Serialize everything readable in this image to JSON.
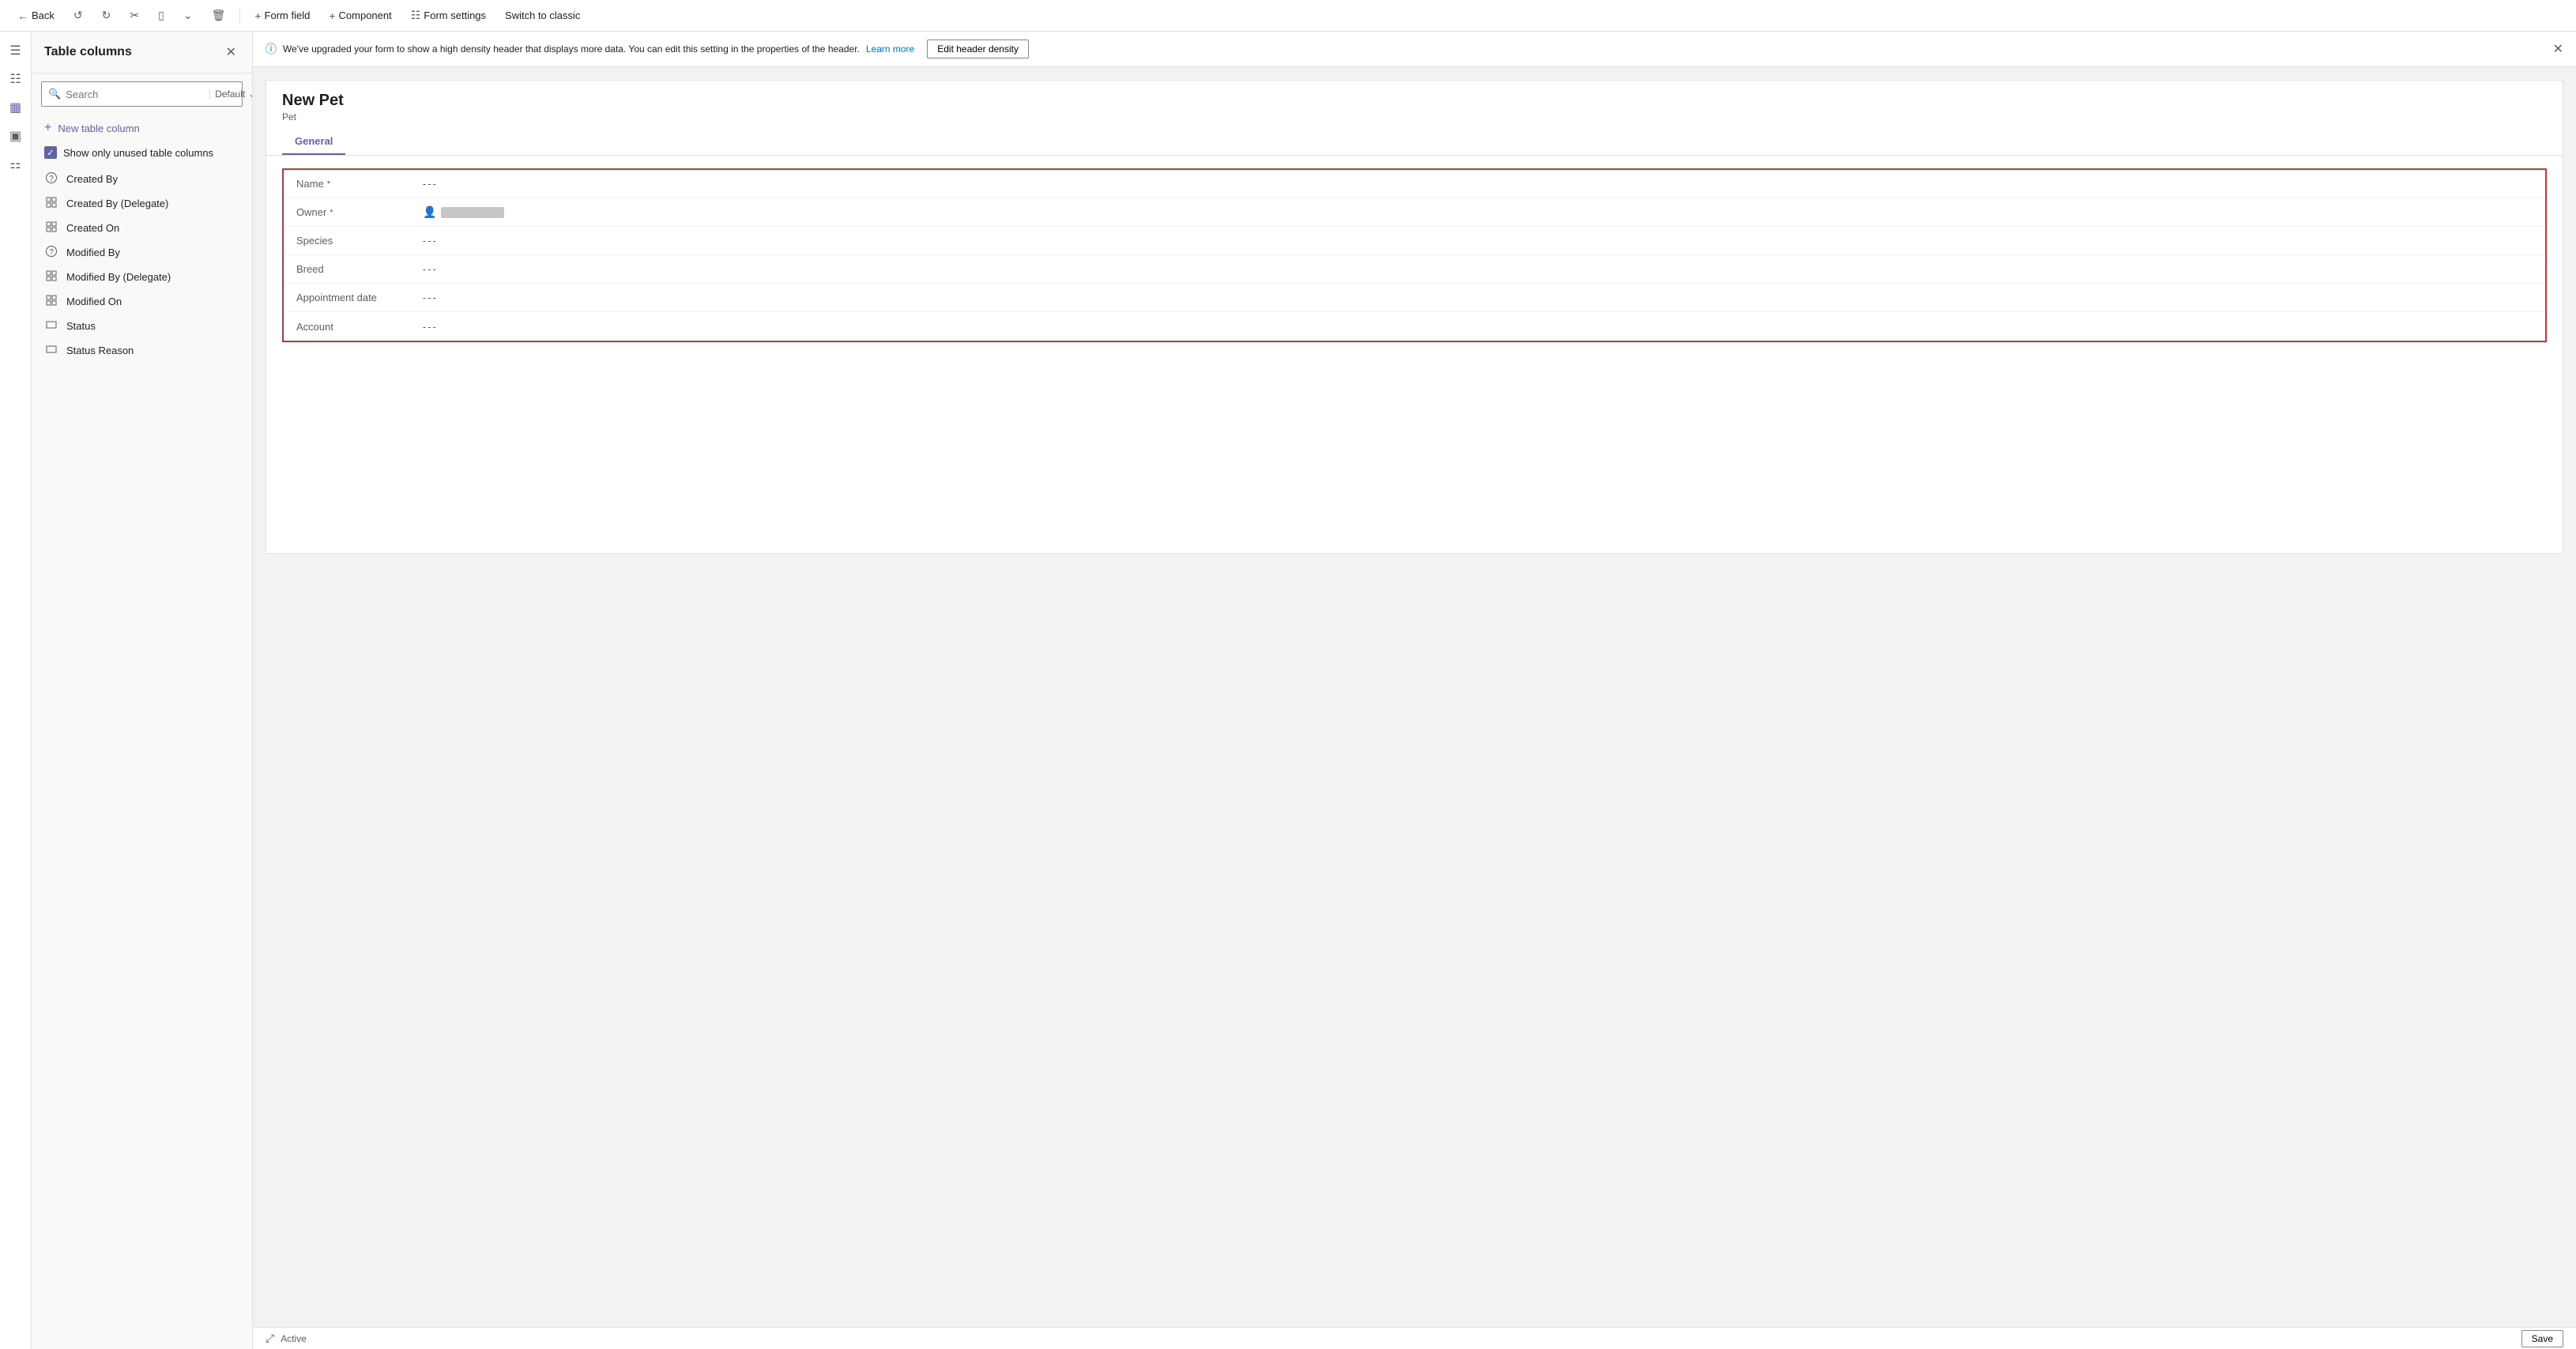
{
  "toolbar": {
    "back_label": "Back",
    "form_field_label": "Form field",
    "component_label": "Component",
    "form_settings_label": "Form settings",
    "switch_classic_label": "Switch to classic"
  },
  "sidebar": {
    "title": "Table columns",
    "search_placeholder": "Search",
    "filter_label": "Default",
    "new_column_label": "New table column",
    "show_unused_label": "Show only unused table columns",
    "items": [
      {
        "id": "created-by",
        "label": "Created By",
        "icon": "?"
      },
      {
        "id": "created-by-delegate",
        "label": "Created By (Delegate)",
        "icon": "⊞"
      },
      {
        "id": "created-on",
        "label": "Created On",
        "icon": "⊞"
      },
      {
        "id": "modified-by",
        "label": "Modified By",
        "icon": "?"
      },
      {
        "id": "modified-by-delegate",
        "label": "Modified By (Delegate)",
        "icon": "⊞"
      },
      {
        "id": "modified-on",
        "label": "Modified On",
        "icon": "⊞"
      },
      {
        "id": "status",
        "label": "Status",
        "icon": "▭"
      },
      {
        "id": "status-reason",
        "label": "Status Reason",
        "icon": "▭"
      }
    ]
  },
  "banner": {
    "message": "We've upgraded your form to show a high density header that displays more data. You can edit this setting in the properties of the header.",
    "learn_more": "Learn more",
    "edit_density_btn": "Edit header density"
  },
  "form": {
    "title": "New Pet",
    "subtitle": "Pet",
    "tab_label": "General",
    "fields": [
      {
        "label": "Name",
        "required": true,
        "value": "---",
        "type": "text"
      },
      {
        "label": "Owner",
        "required": true,
        "value": "",
        "type": "owner"
      },
      {
        "label": "Species",
        "required": false,
        "value": "---",
        "type": "text"
      },
      {
        "label": "Breed",
        "required": false,
        "value": "---",
        "type": "text"
      },
      {
        "label": "Appointment date",
        "required": false,
        "value": "---",
        "type": "text"
      },
      {
        "label": "Account",
        "required": false,
        "value": "---",
        "type": "text"
      }
    ]
  },
  "status_bar": {
    "expand_label": "⤢",
    "status_label": "Active",
    "save_label": "Save"
  },
  "colors": {
    "accent": "#6264a7",
    "danger": "#d13438",
    "link": "#0078d4"
  }
}
